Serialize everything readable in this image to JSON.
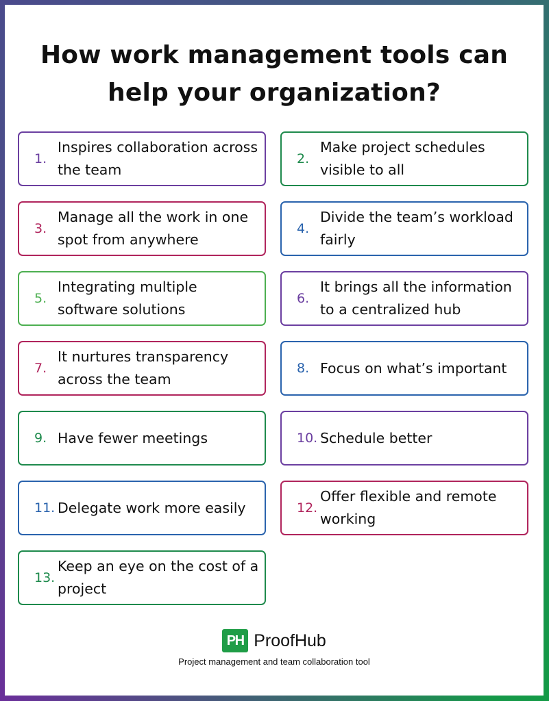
{
  "title_line1": "How work management tools can",
  "title_line2": "help your organization?",
  "colors": {
    "purple": "#6b3fa0",
    "green": "#1e8a4c",
    "crimson": "#b0245c",
    "blue": "#2a63ad",
    "light_green": "#4caf50"
  },
  "items": [
    {
      "number": "1.",
      "text": "Inspires collaboration across the team",
      "color": "#6b3fa0"
    },
    {
      "number": "2.",
      "text": "Make project schedules visible to all",
      "color": "#1e8a4c"
    },
    {
      "number": "3.",
      "text": "Manage all the work in one spot from anywhere",
      "color": "#b0245c"
    },
    {
      "number": "4.",
      "text": "Divide the team’s workload fairly",
      "color": "#2a63ad"
    },
    {
      "number": "5.",
      "text": "Integrating multiple software solutions",
      "color": "#4caf50"
    },
    {
      "number": "6.",
      "text": "It brings all the information to a centralized hub",
      "color": "#6b3fa0"
    },
    {
      "number": "7.",
      "text": "It nurtures transparency across the team",
      "color": "#b0245c"
    },
    {
      "number": "8.",
      "text": "Focus on what’s important",
      "color": "#2a63ad"
    },
    {
      "number": "9.",
      "text": "Have fewer meetings",
      "color": "#1e8a4c"
    },
    {
      "number": "10.",
      "text": "Schedule better",
      "color": "#6b3fa0"
    },
    {
      "number": "11.",
      "text": "Delegate work more easily",
      "color": "#2a63ad"
    },
    {
      "number": "12.",
      "text": "Offer flexible and remote working",
      "color": "#b0245c"
    },
    {
      "number": "13.",
      "text": "Keep an eye on the cost of a project",
      "color": "#1e8a4c"
    }
  ],
  "footer": {
    "logo_mark": "PH",
    "brand": "ProofHub",
    "tagline": "Project management and team collaboration tool",
    "brand_color": "#1f9d47"
  }
}
